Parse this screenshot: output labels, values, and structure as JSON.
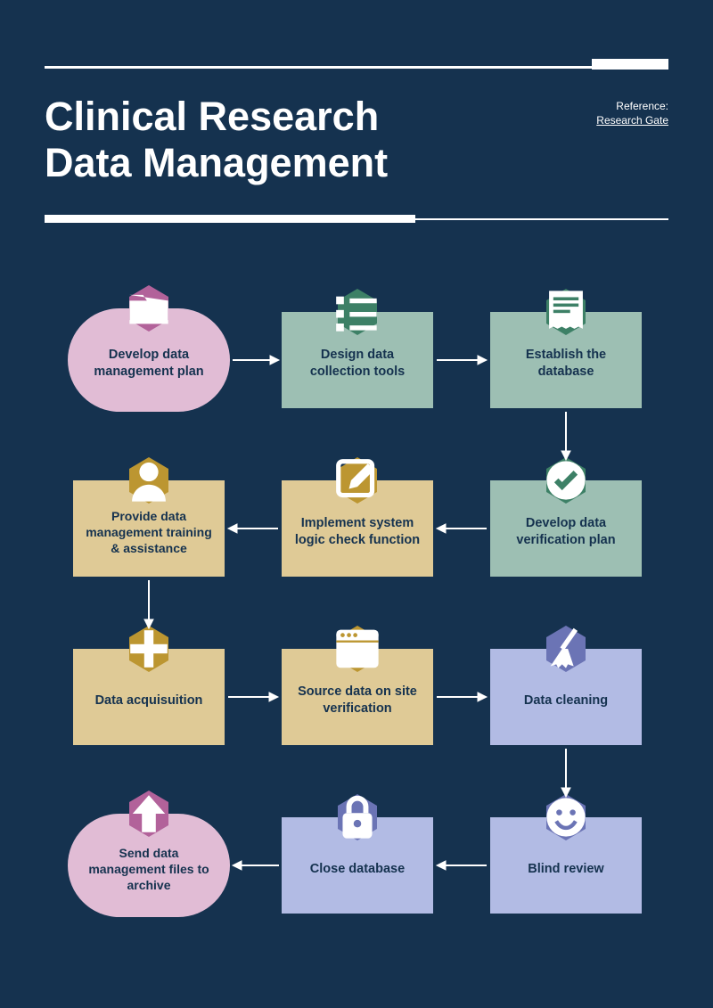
{
  "header": {
    "title_line1": "Clinical Research",
    "title_line2": "Data Management",
    "reference_label": "Reference:",
    "reference_link": "Research Gate"
  },
  "nodes": {
    "n1": {
      "label": "Develop data management plan",
      "icon": "folder"
    },
    "n2": {
      "label": "Design data collection tools",
      "icon": "list"
    },
    "n3": {
      "label": "Establish the database",
      "icon": "receipt"
    },
    "n4": {
      "label": "Develop data verification plan",
      "icon": "check"
    },
    "n5": {
      "label": "Implement system logic check function",
      "icon": "edit"
    },
    "n6": {
      "label": "Provide data management training & assistance",
      "icon": "user"
    },
    "n7": {
      "label": "Data acquisuition",
      "icon": "plus"
    },
    "n8": {
      "label": "Source data on site verification",
      "icon": "window"
    },
    "n9": {
      "label": "Data cleaning",
      "icon": "broom"
    },
    "n10": {
      "label": "Blind review",
      "icon": "smile"
    },
    "n11": {
      "label": "Close database",
      "icon": "lock"
    },
    "n12": {
      "label": "Send data management files to archive",
      "icon": "upload"
    }
  },
  "flow": [
    {
      "from": "n1",
      "to": "n2"
    },
    {
      "from": "n2",
      "to": "n3"
    },
    {
      "from": "n3",
      "to": "n4"
    },
    {
      "from": "n4",
      "to": "n5"
    },
    {
      "from": "n5",
      "to": "n6"
    },
    {
      "from": "n6",
      "to": "n7"
    },
    {
      "from": "n7",
      "to": "n8"
    },
    {
      "from": "n8",
      "to": "n9"
    },
    {
      "from": "n9",
      "to": "n10"
    },
    {
      "from": "n10",
      "to": "n11"
    },
    {
      "from": "n11",
      "to": "n12"
    }
  ],
  "colors": {
    "bg": "#15324f",
    "green": "#9dbfb3",
    "tan": "#dfca96",
    "lilac": "#b2bbe4",
    "pink": "#e1bcd5",
    "hexGreen": "#3d8066",
    "hexTan": "#bc9631",
    "hexLilac": "#6b74b5",
    "hexPink": "#b2629a"
  }
}
